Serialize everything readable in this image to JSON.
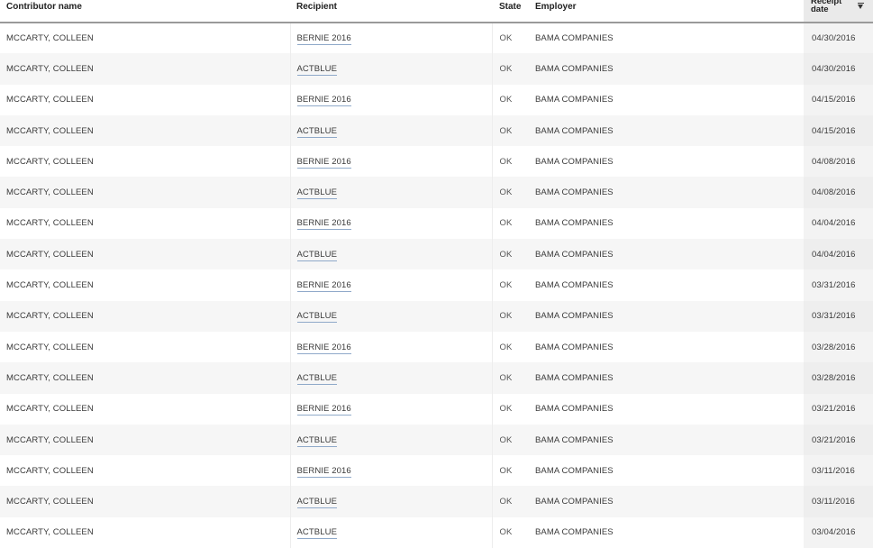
{
  "table": {
    "headers": {
      "contributor": "Contributor name",
      "recipient": "Recipient",
      "state": "State",
      "employer": "Employer",
      "receipt_date": "Receipt date"
    },
    "sort_icon": "sort-descending-icon",
    "rows": [
      {
        "contributor": "MCCARTY, COLLEEN",
        "recipient": "BERNIE 2016",
        "state": "OK",
        "employer": "BAMA COMPANIES",
        "date": "04/30/2016"
      },
      {
        "contributor": "MCCARTY, COLLEEN",
        "recipient": "ACTBLUE",
        "state": "OK",
        "employer": "BAMA COMPANIES",
        "date": "04/30/2016"
      },
      {
        "contributor": "MCCARTY, COLLEEN",
        "recipient": "BERNIE 2016",
        "state": "OK",
        "employer": "BAMA COMPANIES",
        "date": "04/15/2016"
      },
      {
        "contributor": "MCCARTY, COLLEEN",
        "recipient": "ACTBLUE",
        "state": "OK",
        "employer": "BAMA COMPANIES",
        "date": "04/15/2016"
      },
      {
        "contributor": "MCCARTY, COLLEEN",
        "recipient": "BERNIE 2016",
        "state": "OK",
        "employer": "BAMA COMPANIES",
        "date": "04/08/2016"
      },
      {
        "contributor": "MCCARTY, COLLEEN",
        "recipient": "ACTBLUE",
        "state": "OK",
        "employer": "BAMA COMPANIES",
        "date": "04/08/2016"
      },
      {
        "contributor": "MCCARTY, COLLEEN",
        "recipient": "BERNIE 2016",
        "state": "OK",
        "employer": "BAMA COMPANIES",
        "date": "04/04/2016"
      },
      {
        "contributor": "MCCARTY, COLLEEN",
        "recipient": "ACTBLUE",
        "state": "OK",
        "employer": "BAMA COMPANIES",
        "date": "04/04/2016"
      },
      {
        "contributor": "MCCARTY, COLLEEN",
        "recipient": "BERNIE 2016",
        "state": "OK",
        "employer": "BAMA COMPANIES",
        "date": "03/31/2016"
      },
      {
        "contributor": "MCCARTY, COLLEEN",
        "recipient": "ACTBLUE",
        "state": "OK",
        "employer": "BAMA COMPANIES",
        "date": "03/31/2016"
      },
      {
        "contributor": "MCCARTY, COLLEEN",
        "recipient": "BERNIE 2016",
        "state": "OK",
        "employer": "BAMA COMPANIES",
        "date": "03/28/2016"
      },
      {
        "contributor": "MCCARTY, COLLEEN",
        "recipient": "ACTBLUE",
        "state": "OK",
        "employer": "BAMA COMPANIES",
        "date": "03/28/2016"
      },
      {
        "contributor": "MCCARTY, COLLEEN",
        "recipient": "BERNIE 2016",
        "state": "OK",
        "employer": "BAMA COMPANIES",
        "date": "03/21/2016"
      },
      {
        "contributor": "MCCARTY, COLLEEN",
        "recipient": "ACTBLUE",
        "state": "OK",
        "employer": "BAMA COMPANIES",
        "date": "03/21/2016"
      },
      {
        "contributor": "MCCARTY, COLLEEN",
        "recipient": "BERNIE 2016",
        "state": "OK",
        "employer": "BAMA COMPANIES",
        "date": "03/11/2016"
      },
      {
        "contributor": "MCCARTY, COLLEEN",
        "recipient": "ACTBLUE",
        "state": "OK",
        "employer": "BAMA COMPANIES",
        "date": "03/11/2016"
      },
      {
        "contributor": "MCCARTY, COLLEEN",
        "recipient": "ACTBLUE",
        "state": "OK",
        "employer": "BAMA COMPANIES",
        "date": "03/04/2016"
      }
    ]
  }
}
